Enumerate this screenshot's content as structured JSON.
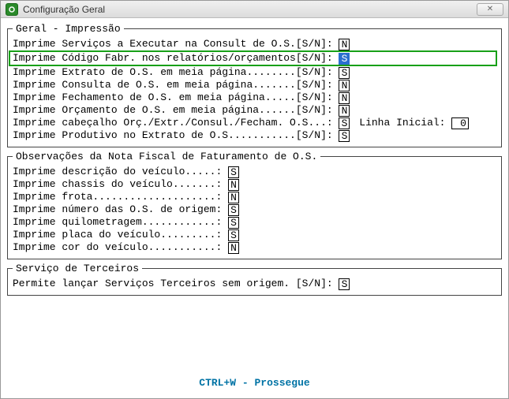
{
  "window": {
    "title": "Configuração Geral",
    "close_glyph": "✕"
  },
  "group_print": {
    "legend": "Geral - Impressão",
    "rows": [
      {
        "label": "Imprime Serviços a Executar na Consult de O.S.[S/N]: ",
        "value": "N",
        "highlight": false
      },
      {
        "label": "Imprime Código Fabr. nos relatórios/orçamentos[S/N]: ",
        "value": "S",
        "highlight": true,
        "selected": true
      },
      {
        "label": "Imprime Extrato de O.S. em meia página........[S/N]: ",
        "value": "S",
        "highlight": false
      },
      {
        "label": "Imprime Consulta de O.S. em meia página.......[S/N]: ",
        "value": "N",
        "highlight": false
      },
      {
        "label": "Imprime Fechamento de O.S. em meia página.....[S/N]: ",
        "value": "N",
        "highlight": false
      },
      {
        "label": "Imprime Orçamento de O.S. em meia página......[S/N]: ",
        "value": "N",
        "highlight": false
      },
      {
        "label": "Imprime cabeçalho Orç./Extr./Consul./Fecham. O.S...: ",
        "value": "S",
        "highlight": false,
        "extra_label": " Linha Inicial: ",
        "extra_value": " 0"
      },
      {
        "label": "Imprime Produtivo no Extrato de O.S...........[S/N]: ",
        "value": "S",
        "highlight": false
      }
    ]
  },
  "group_obs": {
    "legend": "Observações da Nota Fiscal de Faturamento de O.S.",
    "rows": [
      {
        "label": "Imprime descrição do veículo.....: ",
        "value": "S"
      },
      {
        "label": "Imprime chassis do veículo.......: ",
        "value": "N"
      },
      {
        "label": "Imprime frota....................: ",
        "value": "N"
      },
      {
        "label": "Imprime número das O.S. de origem: ",
        "value": "S"
      },
      {
        "label": "Imprime quilometragem............: ",
        "value": "S"
      },
      {
        "label": "Imprime placa do veículo.........: ",
        "value": "S"
      },
      {
        "label": "Imprime cor do veículo...........: ",
        "value": "N"
      }
    ]
  },
  "group_terc": {
    "legend": "Serviço de Terceiros",
    "rows": [
      {
        "label": "Permite lançar Serviços Terceiros sem origem. [S/N]: ",
        "value": "S"
      }
    ]
  },
  "footer": "CTRL+W - Prossegue"
}
